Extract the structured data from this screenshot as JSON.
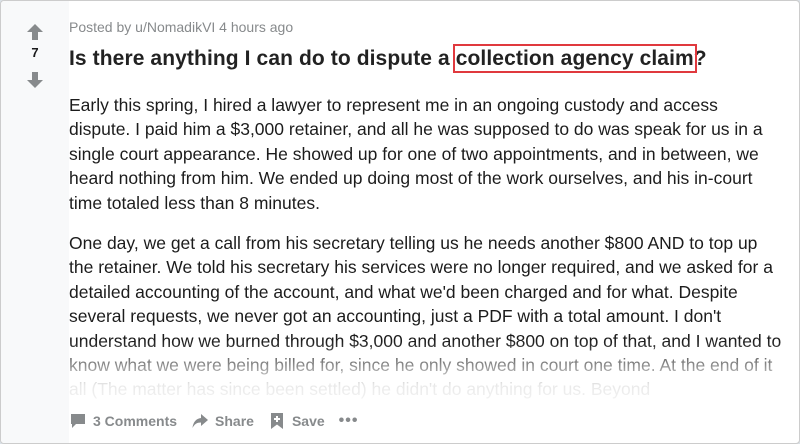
{
  "post": {
    "meta": "Posted by u/NomadikVI 4 hours ago",
    "score": "7",
    "title_before": "Is there anything I can do to dispute a ",
    "title_highlight": "collection agency claim",
    "title_after": "?",
    "paragraphs": [
      "Early this spring, I hired a lawyer to represent me in an ongoing custody and access dispute. I paid him a $3,000 retainer, and all he was supposed to do was speak for us in a single court appearance. He showed up for one of two appointments, and in between, we heard nothing from him. We ended up doing most of the work ourselves, and his in-court time totaled less than 8 minutes.",
      "One day, we get a call from his secretary telling us he needs another $800 AND to top up the retainer. We told his secretary his services were no longer required, and we asked for a detailed accounting of the account, and what we'd been charged and for what. Despite several requests, we never got an accounting, just a PDF with a total amount. I don't understand how we burned through $3,000 and another $800 on top of that, and I wanted to know what we were being billed for, since he only showed in court one time. At the end of it all (The matter has since been settled) he didn't do anything for us. Beyond"
    ]
  },
  "actions": {
    "comments": "3 Comments",
    "share": "Share",
    "save": "Save",
    "more": "•••"
  },
  "icons": {
    "upvote": "upvote-arrow-icon",
    "downvote": "downvote-arrow-icon",
    "comment": "comment-bubble-icon",
    "share": "share-arrow-icon",
    "save": "bookmark-plus-icon"
  },
  "colors": {
    "highlight_box": "#e0393e",
    "meta_text": "#878a8c",
    "vote_arrow": "#878a8c"
  }
}
